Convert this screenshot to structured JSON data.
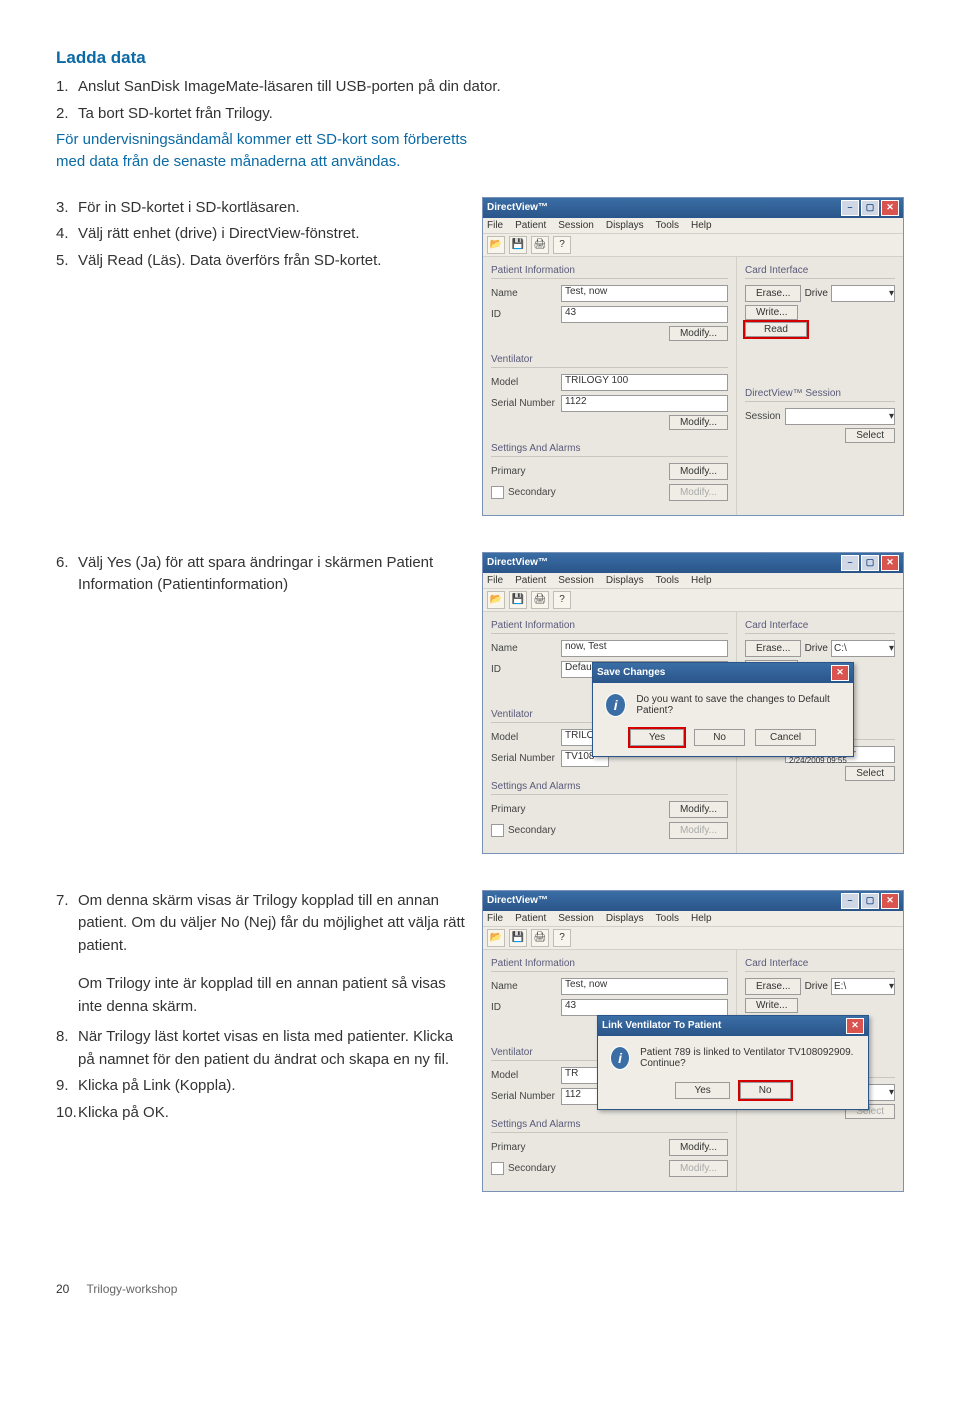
{
  "doc": {
    "section_title": "Ladda data",
    "steps_a": [
      {
        "n": "1.",
        "t": "Anslut SanDisk ImageMate-läsaren till USB-porten på din dator."
      },
      {
        "n": "2.",
        "t": "Ta bort SD-kortet från Trilogy."
      }
    ],
    "note_a": "För undervisningsändamål kommer ett SD-kort som förberetts med data från de senaste månaderna att användas.",
    "steps_b": [
      {
        "n": "3.",
        "t": "För in SD-kortet i SD-kortläsaren."
      },
      {
        "n": "4.",
        "t": "Välj rätt enhet (drive) i DirectView-fönstret."
      },
      {
        "n": "5.",
        "t": "Välj Read (Läs). Data överförs från SD-kortet."
      }
    ],
    "steps_c": [
      {
        "n": "6.",
        "t": "Välj Yes (Ja) för att spara ändringar i skärmen Patient Information (Patientinformation)"
      }
    ],
    "steps_d": [
      {
        "n": "7.",
        "t": "Om denna skärm visas är Trilogy kopplad till en annan patient. Om du väljer No (Nej) får du möjlighet att välja rätt patient."
      }
    ],
    "note_d": "Om Trilogy inte är kopplad till en annan patient så visas inte denna skärm.",
    "steps_e": [
      {
        "n": "8.",
        "t": "När Trilogy läst kortet visas en lista med patienter. Klicka på namnet för den patient du ändrat och skapa en ny fil."
      },
      {
        "n": "9.",
        "t": "Klicka på Link (Koppla)."
      },
      {
        "n": "10.",
        "t": "Klicka på OK."
      }
    ],
    "footer_page": "20",
    "footer_text": "Trilogy-workshop"
  },
  "app": {
    "title": "DirectView™",
    "menus": [
      "File",
      "Patient",
      "Session",
      "Displays",
      "Tools",
      "Help"
    ],
    "groups": {
      "patient_info": "Patient Information",
      "ventilator": "Ventilator",
      "settings": "Settings And Alarms",
      "card": "Card Interface",
      "session": "DirectView™ Session"
    },
    "labels": {
      "name": "Name",
      "id": "ID",
      "model": "Model",
      "serial": "Serial Number",
      "primary": "Primary",
      "secondary": "Secondary",
      "session": "Session",
      "drive": "Drive"
    },
    "buttons": {
      "modify": "Modify...",
      "erase": "Erase...",
      "write": "Write...",
      "read": "Read",
      "select": "Select",
      "yes": "Yes",
      "no": "No",
      "cancel": "Cancel"
    }
  },
  "shot1": {
    "name": "Test, now",
    "id": "43",
    "model": "TRILOGY 100",
    "serial": "1122",
    "drive": "",
    "session": ""
  },
  "shot2": {
    "name": "now, Test",
    "id": "Default Patient",
    "model": "TRILO",
    "serial": "TV108",
    "drive": "C:\\",
    "session": "12/29/2008 07:44 - 2/24/2009 09:55",
    "dialog_title": "Save Changes",
    "dialog_msg": "Do you want to save the changes to Default Patient?"
  },
  "shot3": {
    "name": "Test, now",
    "id": "43",
    "model": "TR",
    "serial": "112",
    "drive": "E:\\",
    "session": "",
    "dialog_title": "Link Ventilator To Patient",
    "dialog_msg": "Patient 789 is linked to Ventilator TV108092909.  Continue?"
  }
}
